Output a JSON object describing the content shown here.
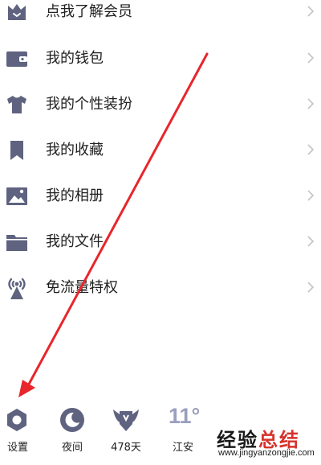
{
  "menu": {
    "items": [
      {
        "label": "点我了解会员",
        "icon": "vip-crown-icon"
      },
      {
        "label": "我的钱包",
        "icon": "wallet-icon"
      },
      {
        "label": "我的个性装扮",
        "icon": "tshirt-icon"
      },
      {
        "label": "我的收藏",
        "icon": "bookmark-icon"
      },
      {
        "label": "我的相册",
        "icon": "photo-album-icon"
      },
      {
        "label": "我的文件",
        "icon": "folder-icon"
      },
      {
        "label": "免流量特权",
        "icon": "broadcast-icon"
      }
    ]
  },
  "bottom_bar": {
    "settings_label": "设置",
    "night_label": "夜间",
    "days_label": "478天",
    "weather_temp": "11°",
    "weather_city": "江安"
  },
  "watermark": {
    "title_part1": "经验",
    "title_part2": "总结",
    "url": "www.jingyanzongjie.com"
  },
  "colors": {
    "icon": "#5f6380",
    "chevron": "#c4c4c8",
    "arrow": "#e8262b",
    "weather": "#9a9fbd",
    "watermark_red": "#d6322b"
  }
}
